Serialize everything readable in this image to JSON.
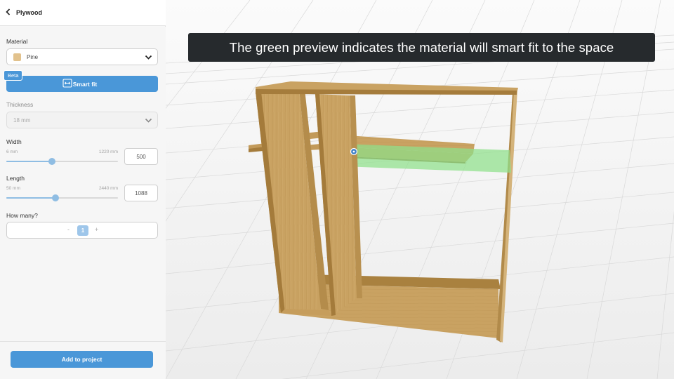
{
  "header": {
    "back_icon": "chevron-left-icon",
    "title": "Plywood"
  },
  "material": {
    "label": "Material",
    "selected": "Pine",
    "swatch_color": "#e2c28d"
  },
  "smart_fit": {
    "badge": "Beta",
    "label": "Smart fit",
    "icon": "smart-fit-icon",
    "accent": "#4a97d8"
  },
  "thickness": {
    "label": "Thickness",
    "selected": "18 mm"
  },
  "width": {
    "label": "Width",
    "min_label": "6 mm",
    "max_label": "1220 mm",
    "value": "500",
    "fraction": 0.41
  },
  "length": {
    "label": "Length",
    "min_label": "50 mm",
    "max_label": "2440 mm",
    "value": "1088",
    "fraction": 0.44
  },
  "quantity": {
    "label": "How many?",
    "minus": "-",
    "value": "1",
    "plus": "+"
  },
  "footer": {
    "add_label": "Add to project"
  },
  "viewport": {
    "banner": "The green preview indicates the material will smart fit to the space",
    "wood_color": "#c99f5a",
    "preview_color": "#8fe08a"
  }
}
